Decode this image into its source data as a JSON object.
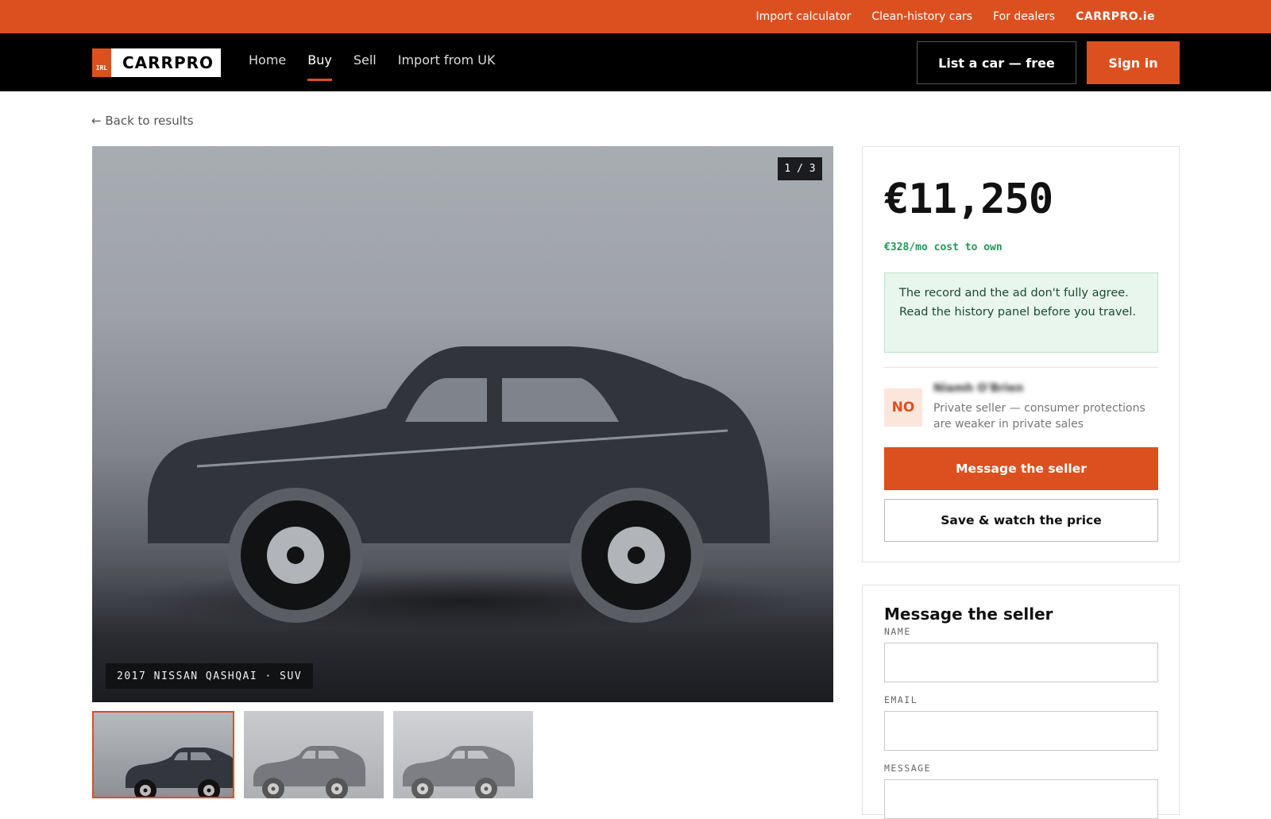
{
  "utility_bar": {
    "links": [
      "Import calculator",
      "Clean-history cars",
      "For dealers"
    ],
    "brand": "CARRPRO.ie"
  },
  "nav": {
    "logo_badge": "IRL",
    "logo_text": "CARRPRO",
    "links": [
      "Home",
      "Buy",
      "Sell",
      "Import from UK"
    ],
    "active": "Buy",
    "list_button": "List a car — free",
    "signin_button": "Sign in"
  },
  "back_link": "← Back to results",
  "gallery": {
    "counter": "1 / 3",
    "caption": "2017 NISSAN QASHQAI · SUV",
    "thumbnail_count": 3
  },
  "listing": {
    "price": "€11,250",
    "monthly": "€328/mo cost to own",
    "notice": "The record and the ad don't fully agree. Read the history panel before you travel.",
    "seller": {
      "initials": "NO",
      "name": "Niamh O'Brien",
      "note": "Private seller — consumer protections are weaker in private sales"
    },
    "message_button": "Message the seller",
    "save_button": "Save & watch the price"
  },
  "message_form": {
    "title": "Message the seller",
    "name_label": "NAME",
    "email_label": "EMAIL",
    "message_label": "MESSAGE",
    "name_value": "",
    "email_value": "",
    "message_value": ""
  },
  "colors": {
    "accent": "#dc5020",
    "nav_bg": "#000000",
    "success_text": "#1f9a57",
    "notice_bg": "#e8f6ee"
  }
}
